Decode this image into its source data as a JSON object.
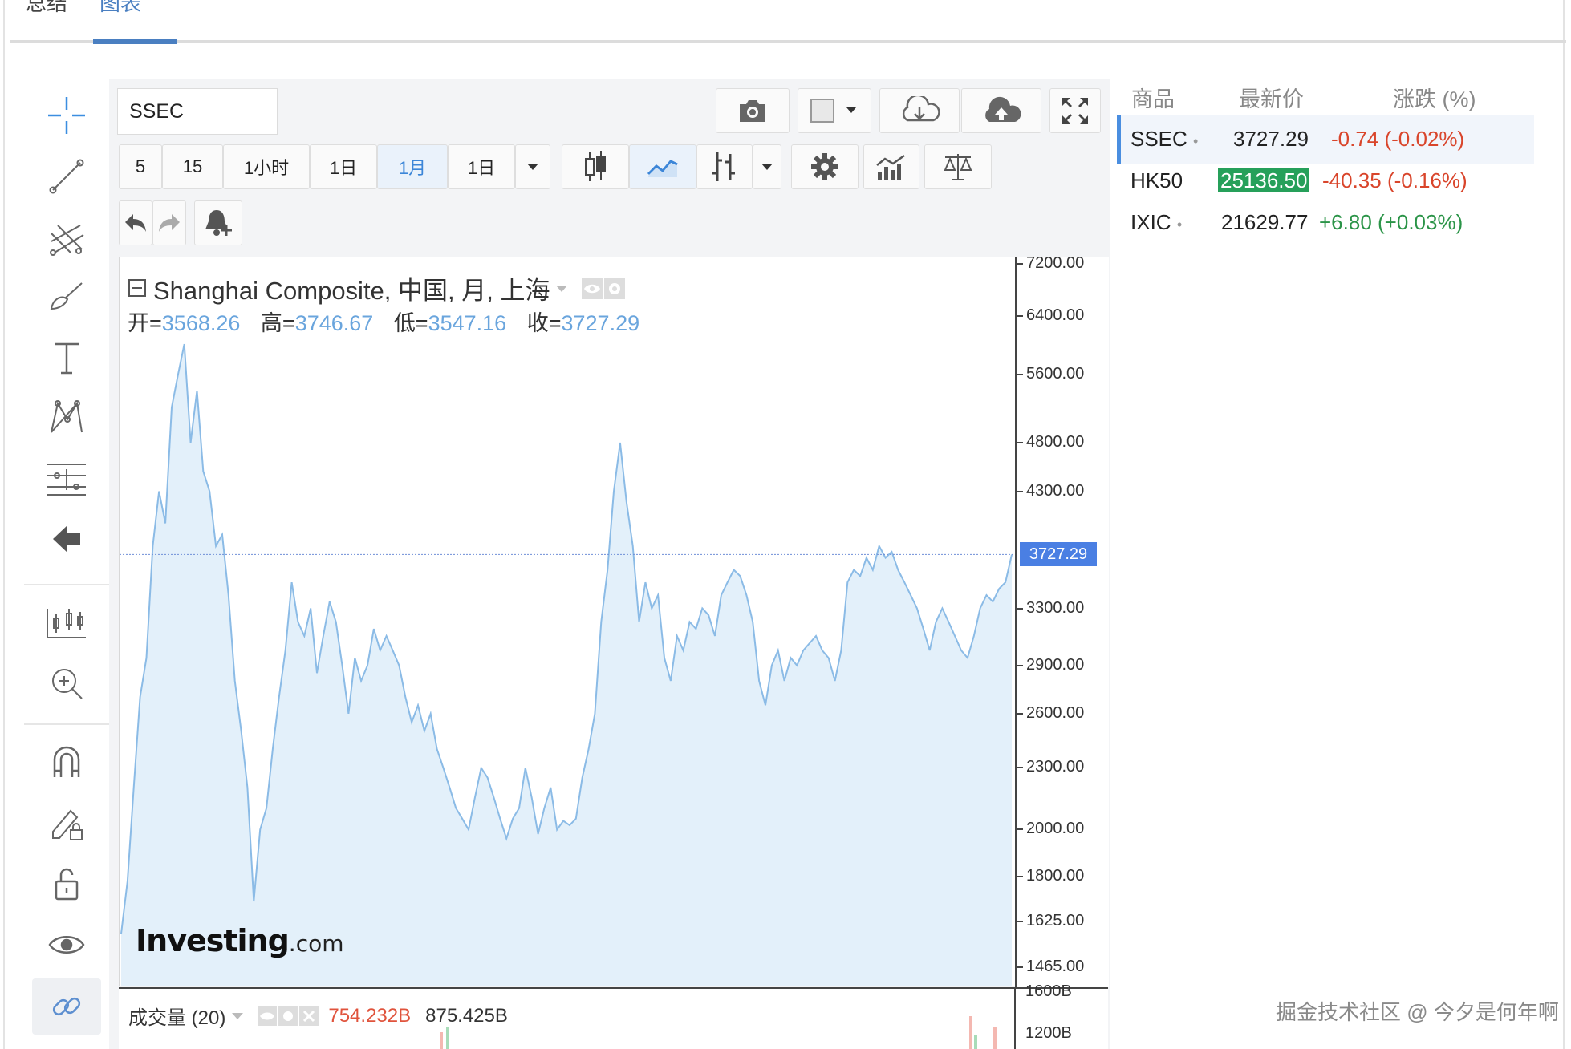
{
  "tabs": {
    "summary": "总结",
    "chart": "图表"
  },
  "symbol": "SSEC",
  "intervals": [
    "5",
    "15",
    "1小时",
    "1日",
    "1月",
    "1日"
  ],
  "active_interval_index": 4,
  "legend": {
    "title": "Shanghai Composite, 中国, 月, 上海",
    "open_label": "开=",
    "open": "3568.26",
    "high_label": "高=",
    "high": "3746.67",
    "low_label": "低=",
    "low": "3547.16",
    "close_label": "收=",
    "close": "3727.29"
  },
  "price_axis": {
    "labels": [
      "7200.00",
      "6400.00",
      "5600.00",
      "4800.00",
      "4300.00",
      "3300.00",
      "2900.00",
      "2600.00",
      "2300.00",
      "2000.00",
      "1800.00",
      "1625.00",
      "1465.00"
    ],
    "last_price": "3727.29"
  },
  "volume": {
    "label": "成交量 (20)",
    "value1": "754.232B",
    "value2": "875.425B",
    "axis_labels": [
      "1600B",
      "1200B"
    ]
  },
  "logo": {
    "main": "Investing",
    "suffix": ".com"
  },
  "watchlist": {
    "headers": {
      "name": "商品",
      "price": "最新价",
      "change": "涨跌 (%)"
    },
    "rows": [
      {
        "name": "SSEC",
        "dot": "•",
        "price": "3727.29",
        "change": "-0.74 (-0.02%)",
        "trend": "down"
      },
      {
        "name": "HK50",
        "dot": "",
        "price": "25136.50",
        "change": "-40.35 (-0.16%)",
        "trend": "down"
      },
      {
        "name": "IXIC",
        "dot": "•",
        "price": "21629.77",
        "change": "+6.80 (+0.03%)",
        "trend": "up"
      }
    ]
  },
  "watermark": "掘金技术社区 @ 今夕是何年啊",
  "chart_data": {
    "type": "area",
    "title": "Shanghai Composite, 中国, 月, 上海",
    "ylabel": "",
    "y_scale": "log",
    "ylim": [
      1400,
      7300
    ],
    "values": [
      1580,
      1780,
      2200,
      2700,
      2950,
      3800,
      4300,
      4000,
      5200,
      5600,
      6000,
      4800,
      5400,
      4500,
      4300,
      3800,
      3900,
      3400,
      2800,
      2500,
      2200,
      1700,
      2000,
      2100,
      2400,
      2700,
      3000,
      3500,
      3200,
      3100,
      3300,
      2850,
      3100,
      3350,
      3200,
      2900,
      2600,
      2950,
      2800,
      2900,
      3150,
      3000,
      3100,
      3000,
      2900,
      2700,
      2550,
      2650,
      2500,
      2600,
      2400,
      2300,
      2200,
      2100,
      2050,
      2000,
      2150,
      2300,
      2250,
      2150,
      2050,
      1960,
      2050,
      2100,
      2300,
      2150,
      1980,
      2100,
      2200,
      2000,
      2040,
      2020,
      2050,
      2250,
      2400,
      2600,
      3200,
      3600,
      4300,
      4800,
      4200,
      3800,
      3200,
      3500,
      3300,
      3400,
      2950,
      2800,
      3100,
      3000,
      3200,
      3150,
      3300,
      3250,
      3100,
      3400,
      3500,
      3600,
      3550,
      3400,
      3200,
      2800,
      2650,
      2900,
      3000,
      2800,
      2950,
      2900,
      3000,
      3050,
      3100,
      3000,
      2950,
      2800,
      3000,
      3500,
      3600,
      3550,
      3700,
      3600,
      3800,
      3700,
      3750,
      3600,
      3500,
      3400,
      3300,
      3150,
      3000,
      3200,
      3300,
      3200,
      3100,
      3000,
      2950,
      3100,
      3300,
      3400,
      3350,
      3450,
      3500,
      3727
    ]
  }
}
